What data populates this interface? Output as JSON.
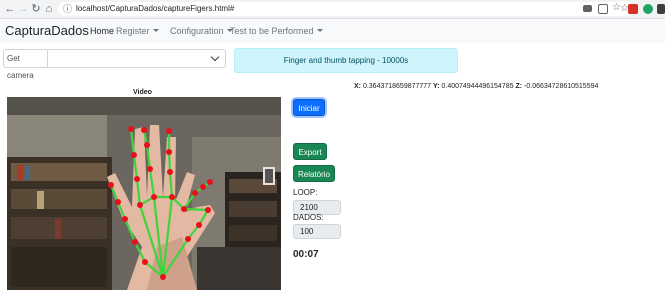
{
  "browser": {
    "url": "localhost/CapturaDados/captureFigers.html#"
  },
  "navbar": {
    "brand": "CapturaDados",
    "items": [
      {
        "label": "Home",
        "dropdown": false
      },
      {
        "label": "Register",
        "dropdown": true
      },
      {
        "label": "Configuration",
        "dropdown": true
      },
      {
        "label": "Test to be Performed",
        "dropdown": true
      }
    ]
  },
  "camera": {
    "button_label": "Get camera",
    "selected": ""
  },
  "test_banner": "Finger and thumb tapping - 10000s",
  "coordinates": {
    "x_label": "X:",
    "x_value": "0.3643718659877777",
    "y_label": "Y:",
    "y_value": "0.400749444961547​85",
    "z_label": "Z:",
    "z_value": "-0.06634728610515594"
  },
  "video": {
    "label": "Video",
    "landmark_color": "#e8101a",
    "connection_color": "#3fd43a"
  },
  "buttons": {
    "start": "Iniciar",
    "export": "Export",
    "report": "Relatório"
  },
  "loop": {
    "label": "LOOP:",
    "value": "2100"
  },
  "dados": {
    "label": "DADOS:",
    "value": "100"
  },
  "timer": "00:07",
  "colors": {
    "primary": "#0d6efd",
    "success": "#198754",
    "info_bg": "#cff4fc"
  }
}
